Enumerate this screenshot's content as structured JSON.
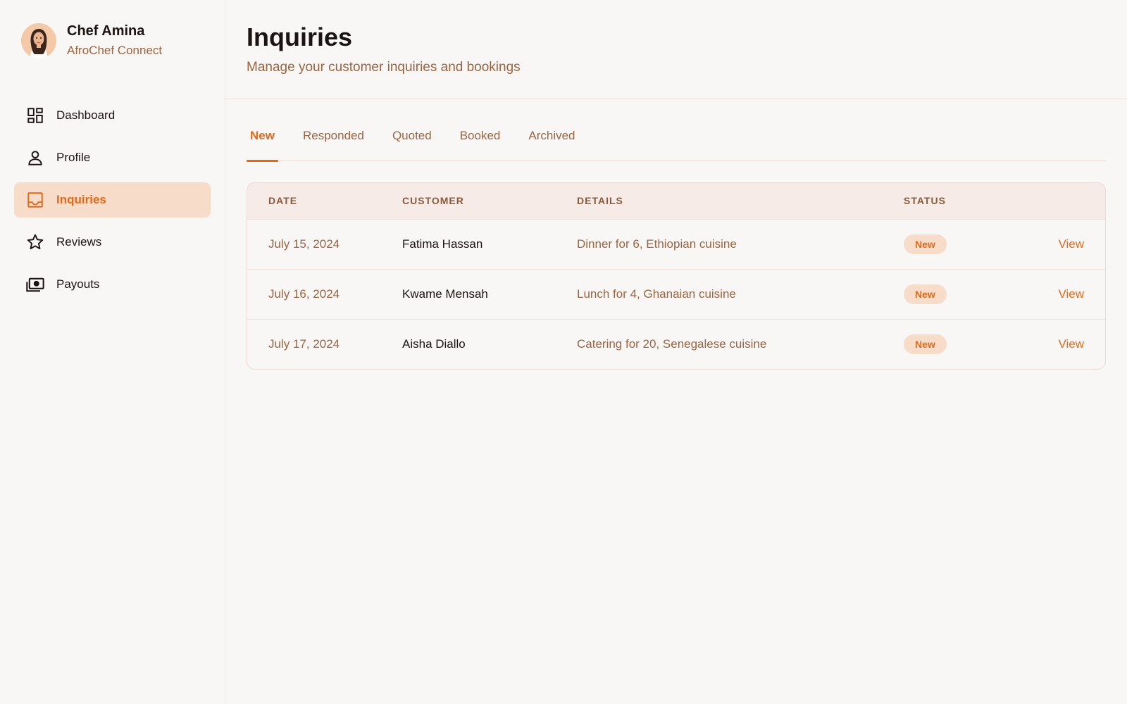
{
  "user": {
    "name": "Chef Amina",
    "brand": "AfroChef Connect"
  },
  "sidebar": {
    "items": [
      {
        "label": "Dashboard",
        "icon": "dashboard-icon"
      },
      {
        "label": "Profile",
        "icon": "person-icon"
      },
      {
        "label": "Inquiries",
        "icon": "inbox-icon",
        "active": true
      },
      {
        "label": "Reviews",
        "icon": "star-icon"
      },
      {
        "label": "Payouts",
        "icon": "money-icon"
      }
    ]
  },
  "header": {
    "title": "Inquiries",
    "subtitle": "Manage your customer inquiries and bookings"
  },
  "tabs": [
    {
      "label": "New",
      "active": true
    },
    {
      "label": "Responded"
    },
    {
      "label": "Quoted"
    },
    {
      "label": "Booked"
    },
    {
      "label": "Archived"
    }
  ],
  "table": {
    "columns": [
      "DATE",
      "CUSTOMER",
      "DETAILS",
      "STATUS"
    ],
    "rows": [
      {
        "date": "July 15, 2024",
        "customer": "Fatima Hassan",
        "details": "Dinner for 6, Ethiopian cuisine",
        "status": "New",
        "action": "View"
      },
      {
        "date": "July 16, 2024",
        "customer": "Kwame Mensah",
        "details": "Lunch for 4, Ghanaian cuisine",
        "status": "New",
        "action": "View"
      },
      {
        "date": "July 17, 2024",
        "customer": "Aisha Diallo",
        "details": "Catering for 20, Senegalese cuisine",
        "status": "New",
        "action": "View"
      }
    ]
  },
  "colors": {
    "accent": "#e06a1a",
    "accent_soft": "#f7dcca",
    "muted_text": "#9a6440",
    "background": "#f9f7f6"
  }
}
